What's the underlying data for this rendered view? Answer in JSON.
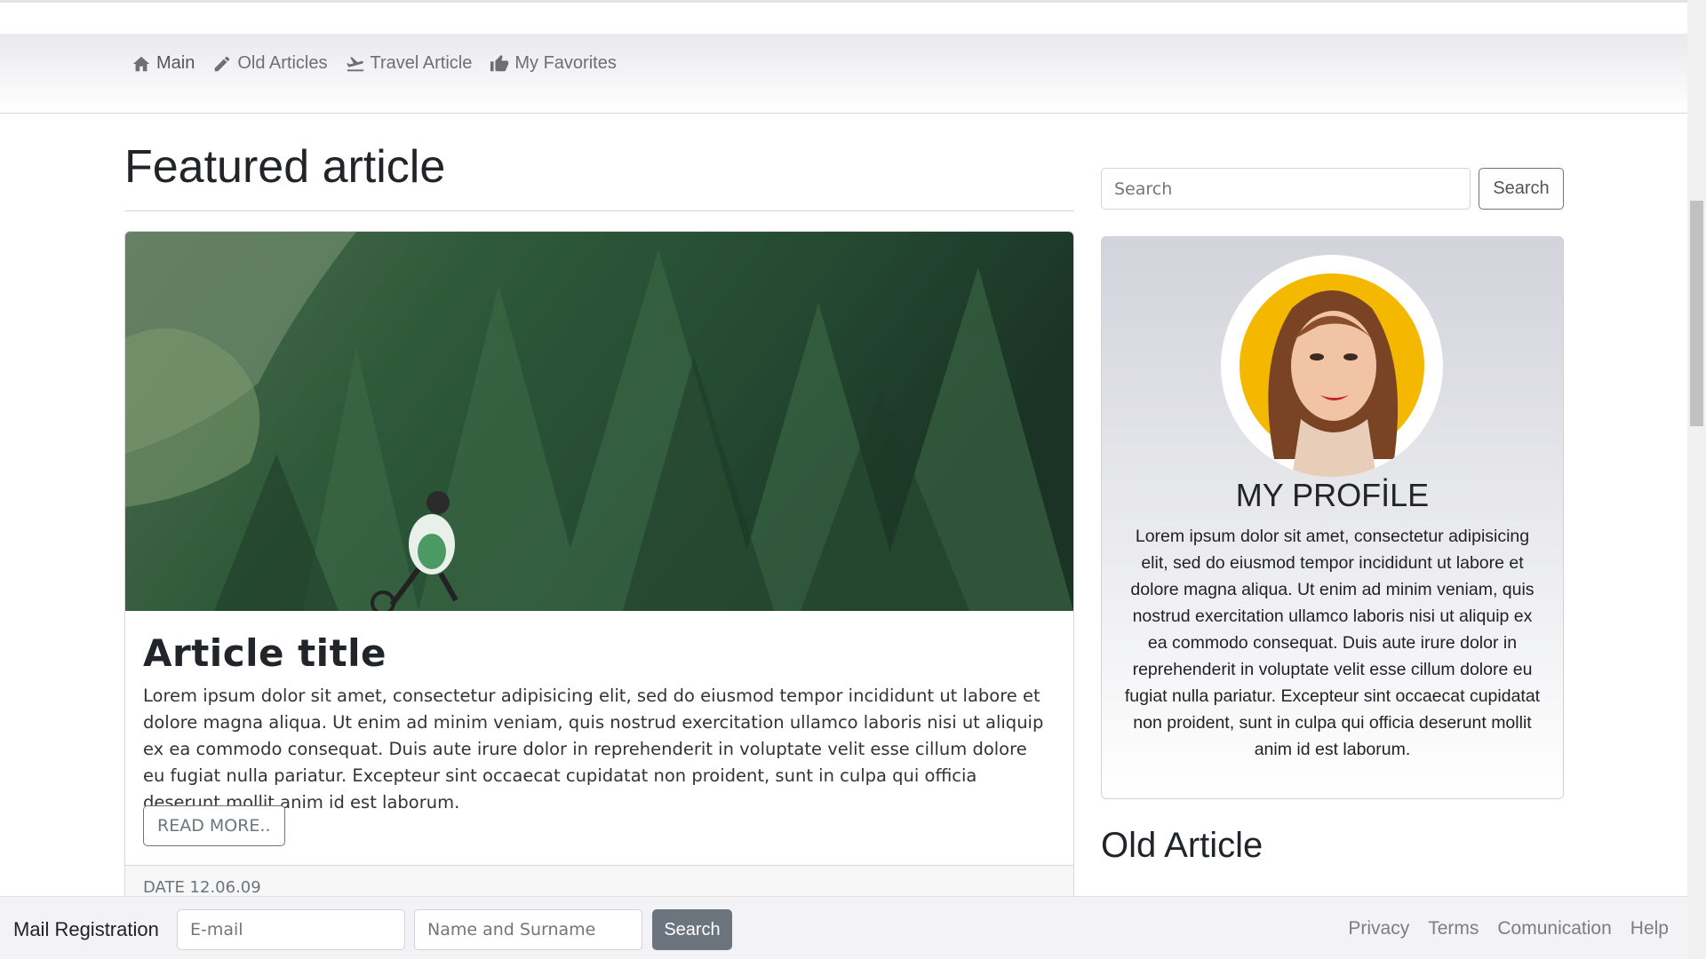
{
  "nav": {
    "items": [
      {
        "label": "Main",
        "icon": "home-icon"
      },
      {
        "label": "Old Articles",
        "icon": "pencil-icon"
      },
      {
        "label": "Travel Article",
        "icon": "plane-icon"
      },
      {
        "label": "My Favorites",
        "icon": "thumbs-up-icon"
      }
    ]
  },
  "main": {
    "title": "Featured article",
    "article": {
      "title": "Article title",
      "text": "Lorem ipsum dolor sit amet, consectetur adipisicing elit, sed do eiusmod tempor incididunt ut labore et dolore magna aliqua. Ut enim ad minim veniam, quis nostrud exercitation ullamco laboris nisi ut aliquip ex ea commodo consequat. Duis aute irure dolor in reprehenderit in voluptate velit esse cillum dolore eu fugiat nulla pariatur. Excepteur sint occaecat cupidatat non proident, sunt in culpa qui officia deserunt mollit anim id est laborum.",
      "read_more": "READ MORE..",
      "date": "DATE 12.06.09"
    }
  },
  "sidebar": {
    "search_placeholder": "Search",
    "search_button": "Search",
    "profile_title": "MY PROFİLE",
    "profile_text": "Lorem ipsum dolor sit amet, consectetur adipisicing elit, sed do eiusmod tempor incididunt ut labore et dolore magna aliqua. Ut enim ad minim veniam, quis nostrud exercitation ullamco laboris nisi ut aliquip ex ea commodo consequat. Duis aute irure dolor in reprehenderit in voluptate velit esse cillum dolore eu fugiat nulla pariatur. Excepteur sint occaecat cupidatat non proident, sunt in culpa qui officia deserunt mollit anim id est laborum.",
    "old_article_title": "Old Article"
  },
  "footer": {
    "mail_label": "Mail Registration",
    "email_placeholder": "E-mail",
    "name_placeholder": "Name and Surname",
    "button": "Search",
    "links": [
      "Privacy",
      "Terms",
      "Comunication",
      "Help"
    ]
  },
  "colors": {
    "button_secondary": "#6c757d",
    "avatar_background": "#f5b800"
  }
}
